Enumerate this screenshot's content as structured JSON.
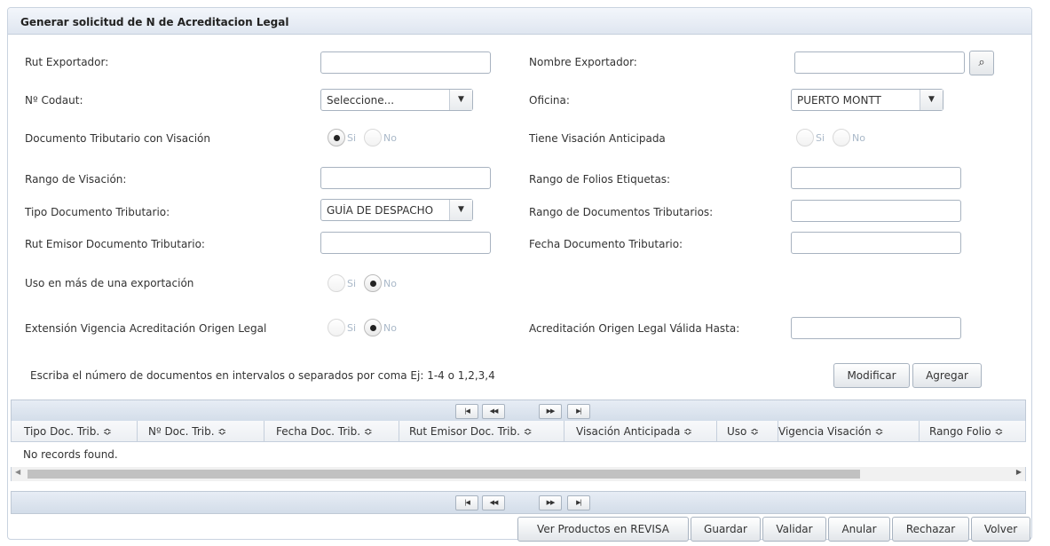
{
  "panel": {
    "title": "Generar solicitud de N de Acreditacion Legal"
  },
  "form": {
    "rut_exportador_label": "Rut Exportador:",
    "rut_exportador_value": "",
    "nombre_exportador_label": "Nombre Exportador:",
    "nombre_exportador_value": "",
    "search_icon": "search-icon",
    "codaut_label": "Nº Codaut:",
    "codaut_value": "Seleccione...",
    "oficina_label": "Oficina:",
    "oficina_value": "PUERTO MONTT",
    "doc_visacion_label": "Documento Tributario con Visación",
    "tiene_visacion_label": "Tiene Visación Anticipada",
    "rango_visacion_label": "Rango de Visación:",
    "rango_folios_label": "Rango de Folios Etiquetas:",
    "tipo_doc_label": "Tipo Documento Tributario:",
    "tipo_doc_value": "GUÍA DE DESPACHO",
    "rango_docs_label": "Rango de Documentos Tributarios:",
    "rut_emisor_label": "Rut Emisor Documento Tributario:",
    "fecha_doc_label": "Fecha Documento Tributario:",
    "uso_label": "Uso en más de una exportación",
    "extension_label": "Extensión Vigencia Acreditación Origen Legal",
    "valida_hasta_label": "Acreditación Origen Legal Válida Hasta:",
    "si": "Si",
    "no": "No",
    "hint": "Escriba el número de documentos en intervalos o separados por coma Ej: 1-4 o 1,2,3,4",
    "modificar": "Modificar",
    "agregar": "Agregar"
  },
  "radios": {
    "doc_visacion": "si",
    "tiene_visacion": "none",
    "uso": "no",
    "extension": "no"
  },
  "table": {
    "columns": [
      "Tipo Doc. Trib. ≎",
      "Nº Doc. Trib. ≎",
      "Fecha Doc. Trib. ≎",
      "Rut Emisor Doc. Trib. ≎",
      "Visación Anticipada ≎",
      "Uso ≎",
      "Vigencia Visación ≎",
      "Rango Folio ≎"
    ],
    "empty_message": "No records found.",
    "pager": {
      "first": "|◀",
      "prev": "◀◀",
      "next": "▶▶",
      "last": "▶|"
    }
  },
  "actions": {
    "ver_productos": "Ver Productos en REVISA",
    "guardar": "Guardar",
    "validar": "Validar",
    "anular": "Anular",
    "rechazar": "Rechazar",
    "volver": "Volver"
  }
}
